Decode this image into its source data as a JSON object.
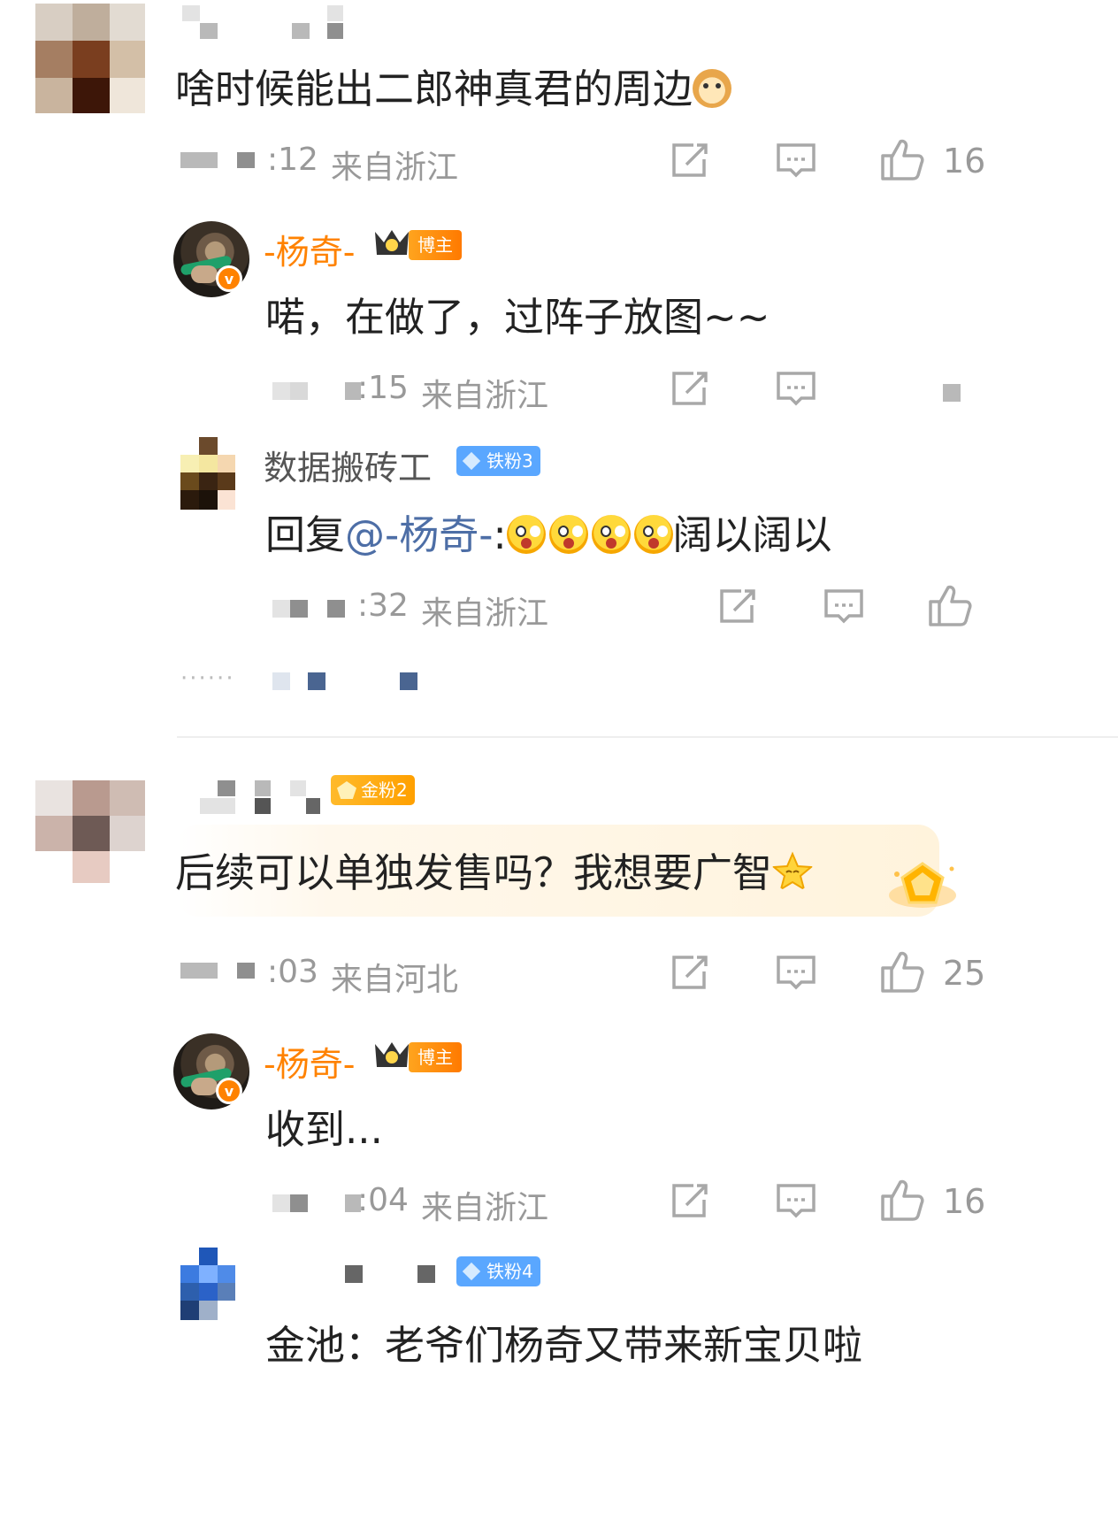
{
  "comments": [
    {
      "text": "啥时候能出二郎神真君的周边",
      "time": ":12",
      "location": "来自浙江",
      "likes": "16",
      "replies": [
        {
          "author": "-杨奇-",
          "badge": "博主",
          "text": "喏，在做了，过阵子放图~~",
          "time": ":15",
          "location": "来自浙江"
        },
        {
          "author": "数据搬砖工",
          "fan_badge": "铁粉3",
          "reply_prefix": "回复",
          "mention": "@-杨奇-",
          "colon": ":",
          "text": "阔以阔以",
          "time": ":32",
          "location": "来自浙江"
        }
      ]
    },
    {
      "fan_badge": "金粉2",
      "text": "后续可以单独发售吗？我想要广智",
      "time": ":03",
      "location": "来自河北",
      "likes": "25",
      "replies": [
        {
          "author": "-杨奇-",
          "badge": "博主",
          "text": "收到...",
          "time": ":04",
          "location": "来自浙江",
          "likes": "16"
        },
        {
          "fan_badge": "铁粉4",
          "text": "金池：老爷们杨奇又带来新宝贝啦"
        }
      ]
    }
  ],
  "more_dots": "······",
  "colors": {
    "accent_orange": "#ff8200",
    "mention_blue": "#4d6ea6",
    "meta_gray": "#999999"
  }
}
